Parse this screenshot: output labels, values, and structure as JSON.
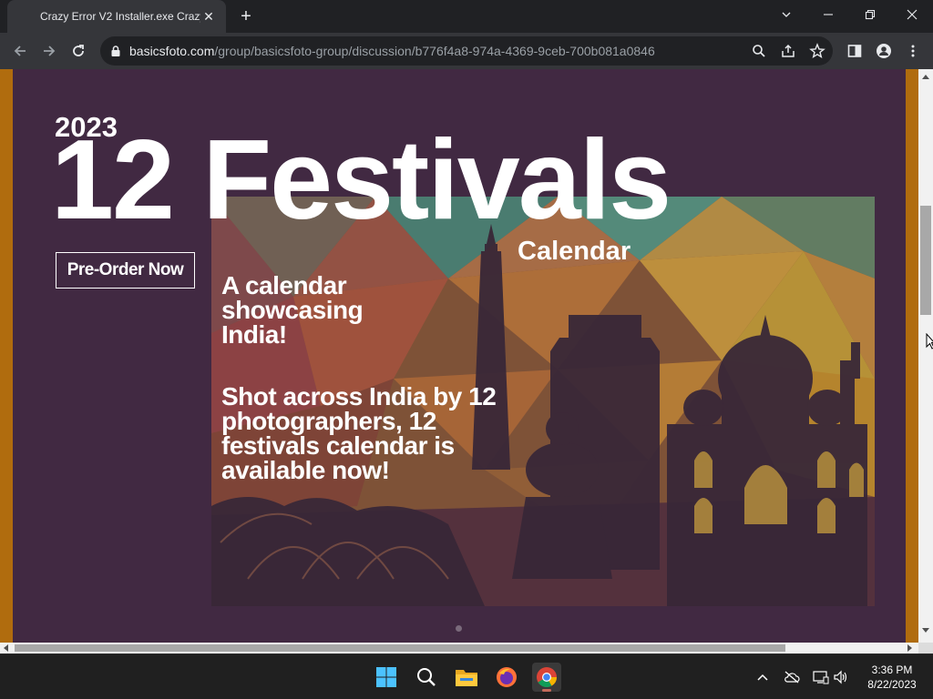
{
  "browser": {
    "tab_title": "Crazy Error V2 Installer.exe Crazy",
    "url_host": "basicsfoto.com",
    "url_path": "/group/basicsfoto-group/discussion/b776f4a8-974a-4369-9ceb-700b081a0846"
  },
  "hero": {
    "year": "2023",
    "headline": "12 Festivals",
    "subhead": "Calendar",
    "cta_label": "Pre-Order Now",
    "tagline": "A calendar showcasing India!",
    "description": "Shot across India by 12 photographers, 12 festivals calendar is available now!"
  },
  "colors": {
    "page_bg": "#412942",
    "side_accent": "#b06c0e",
    "chrome_dark": "#202124",
    "chrome_toolbar": "#35363a"
  },
  "taskbar": {
    "apps": [
      "windows-start-icon",
      "search-icon",
      "file-explorer-icon",
      "firefox-icon",
      "chrome-icon"
    ],
    "time": "3:36 PM",
    "date": "8/22/2023"
  }
}
